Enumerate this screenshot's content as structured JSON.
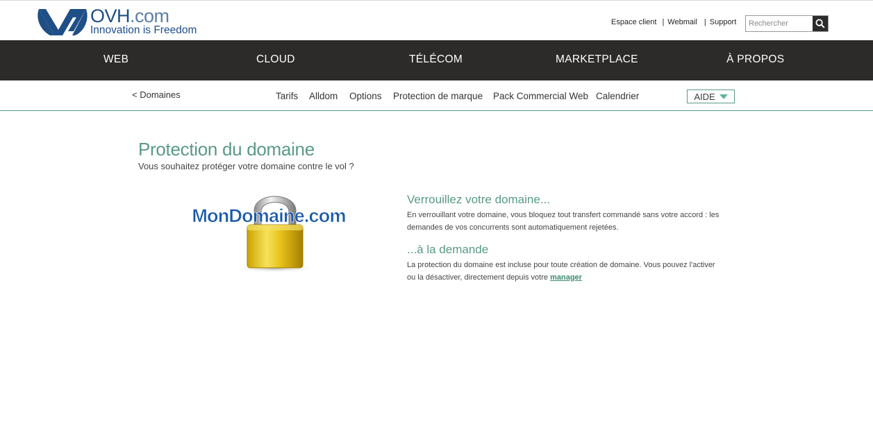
{
  "brand": {
    "name": "OVH",
    "domain_suffix": ".com",
    "tagline": "Innovation is Freedom",
    "color": "#1f4f86"
  },
  "toplinks": {
    "espace_client": "Espace client",
    "webmail": "Webmail",
    "support": "Support",
    "separator": "|"
  },
  "search": {
    "placeholder": "Rechercher",
    "icon": "search-icon"
  },
  "mainnav": {
    "items": [
      "WEB",
      "CLOUD",
      "TÉLÉCOM",
      "MARKETPLACE",
      "À PROPOS"
    ],
    "background": "#2c2b2a"
  },
  "subnav": {
    "back": "< Domaines",
    "links": [
      "Tarifs",
      "Alldom",
      "Options",
      "Protection de marque",
      "Pack Commercial Web",
      "Calendrier"
    ],
    "aide": "AIDE",
    "accent": "#5a9a8a"
  },
  "main": {
    "title": "Protection du domaine",
    "subtitle": "Vous souhaitez protéger votre domaine contre le vol ?",
    "illustration_text": "MonDomaine.com",
    "sections": [
      {
        "heading": "Verrouillez votre domaine...",
        "body": "En verrouillant votre domaine, vous bloquez tout transfert commandé sans votre accord : les demandes de vos concurrents sont automatiquement rejetées."
      },
      {
        "heading": "...à la demande",
        "body": "La protection du domaine est incluse pour toute création de domaine. Vous pouvez l'activer ou la désactiver, directement depuis votre",
        "link": "manager"
      }
    ],
    "accent": "#5a9a82"
  }
}
